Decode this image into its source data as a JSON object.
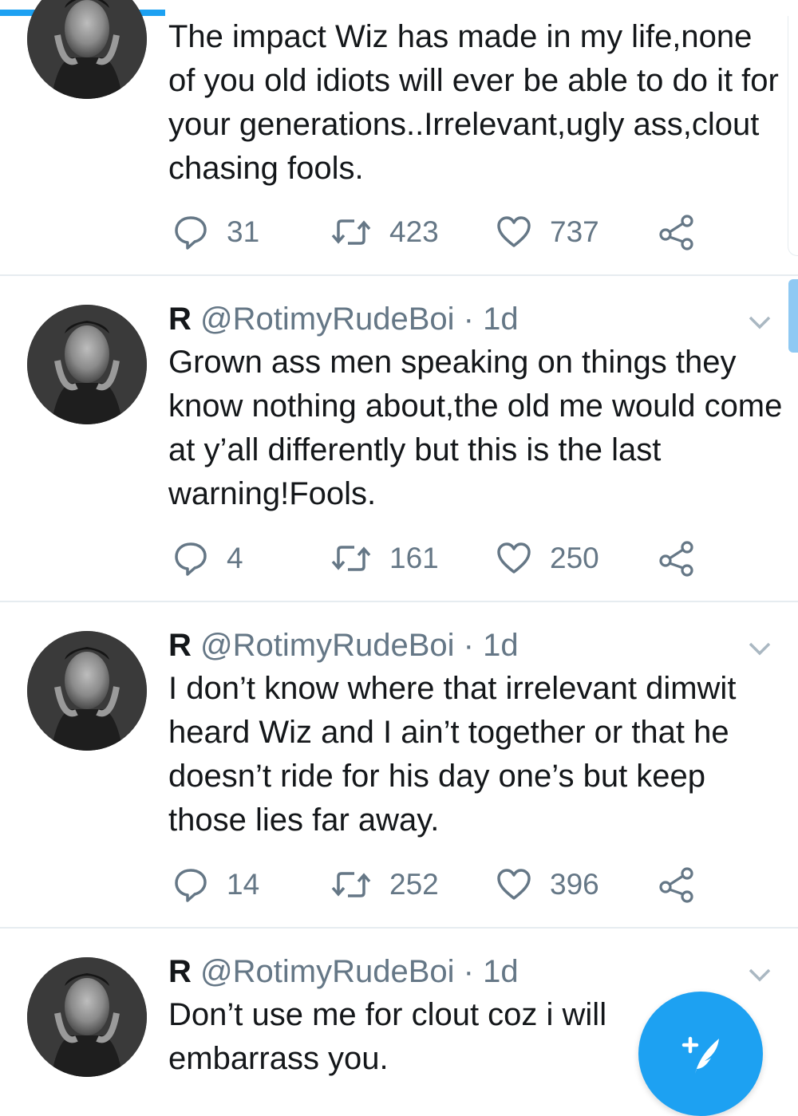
{
  "icons": {
    "reply": "speech-bubble-icon",
    "retweet": "retweet-arrows-icon",
    "like": "heart-outline-icon",
    "share": "share-nodes-icon",
    "caret": "chevron-down-icon",
    "compose": "feather-plus-icon"
  },
  "colors": {
    "accent": "#1da1f2",
    "muted": "#657786",
    "text": "#14171a"
  },
  "tweets": [
    {
      "text": "The impact Wiz has made in my life,none of you old idiots will ever be able to do it for your generations..Irrelevant,ugly ass,clout chasing fools.",
      "stats": {
        "replies": "31",
        "retweets": "423",
        "likes": "737"
      }
    },
    {
      "name": "R",
      "handle": "@RotimyRudeBoi",
      "dot": "·",
      "time": "1d",
      "text": "Grown ass men speaking on things they know nothing about,the old me would come at y’all differently but this is the last warning!Fools.",
      "stats": {
        "replies": "4",
        "retweets": "161",
        "likes": "250"
      }
    },
    {
      "name": "R",
      "handle": "@RotimyRudeBoi",
      "dot": "·",
      "time": "1d",
      "text": "I don’t know where that irrelevant dimwit heard Wiz and I ain’t together or that he doesn’t ride for his day one’s but keep those lies far away.",
      "stats": {
        "replies": "14",
        "retweets": "252",
        "likes": "396"
      }
    },
    {
      "name": "R",
      "handle": "@RotimyRudeBoi",
      "dot": "·",
      "time": "1d",
      "text": "Don’t use me for clout coz i will embarrass you."
    }
  ]
}
